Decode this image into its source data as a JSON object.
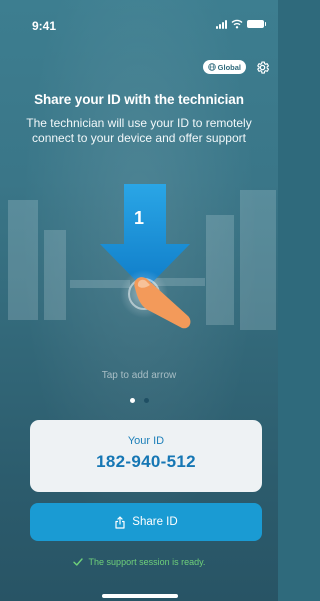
{
  "status_bar": {
    "time": "9:41"
  },
  "top_actions": {
    "region_label": "Global"
  },
  "header": {
    "title": "Share your ID with the technician",
    "subtitle": "The technician will use your ID to remotely connect to your device and offer support"
  },
  "illustration": {
    "step_number": "1",
    "hint": "Tap to add arrow"
  },
  "pagination": {
    "total": 2,
    "active": 0
  },
  "id_card": {
    "label": "Your ID",
    "value": "182-940-512"
  },
  "share_button": {
    "label": "Share ID"
  },
  "session_status": {
    "text": "The support session is ready."
  },
  "colors": {
    "accent": "#1a9bd3",
    "id_text": "#1677b4",
    "ready_green": "#6fd07a",
    "background": "#3a7688"
  }
}
